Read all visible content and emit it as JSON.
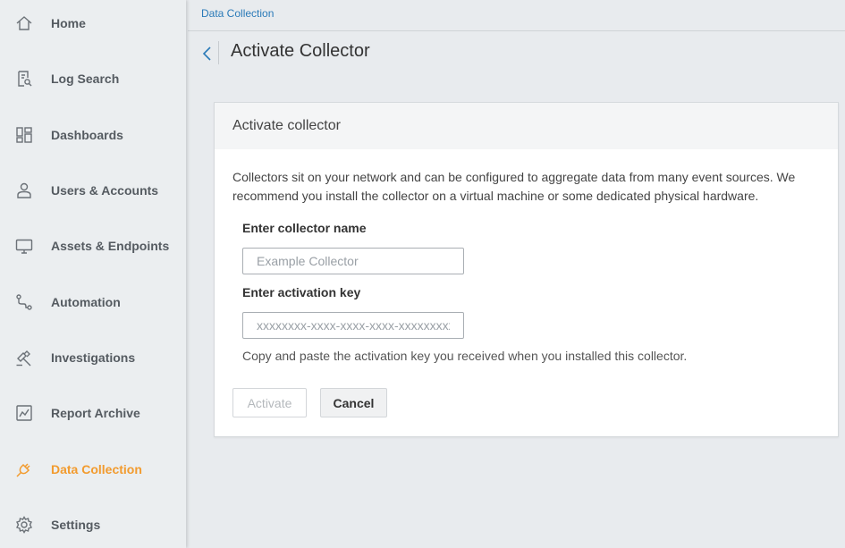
{
  "sidebar": {
    "items": [
      {
        "label": "Home",
        "icon": "home-icon"
      },
      {
        "label": "Log Search",
        "icon": "log-search-icon"
      },
      {
        "label": "Dashboards",
        "icon": "dashboards-icon"
      },
      {
        "label": "Users & Accounts",
        "icon": "user-icon"
      },
      {
        "label": "Assets & Endpoints",
        "icon": "monitor-icon"
      },
      {
        "label": "Automation",
        "icon": "automation-icon"
      },
      {
        "label": "Investigations",
        "icon": "investigations-icon"
      },
      {
        "label": "Report Archive",
        "icon": "report-chart-icon"
      },
      {
        "label": "Data Collection",
        "icon": "plug-icon",
        "active": true
      },
      {
        "label": "Settings",
        "icon": "gear-icon"
      }
    ],
    "active_color": "#f29b2e"
  },
  "header": {
    "breadcrumb": "Data Collection",
    "title": "Activate Collector"
  },
  "card": {
    "title": "Activate collector",
    "description": "Collectors sit on your network and can be configured to aggregate data from many event sources. We recommend you install the collector on a virtual machine or some dedicated physical hardware.",
    "name_label": "Enter collector name",
    "name_placeholder": "Example Collector",
    "key_label": "Enter activation key",
    "key_placeholder": "xxxxxxxx-xxxx-xxxx-xxxx-xxxxxxxxxxxx",
    "help_text": "Copy and paste the activation key you received when you installed this collector.",
    "activate_label": "Activate",
    "cancel_label": "Cancel"
  }
}
